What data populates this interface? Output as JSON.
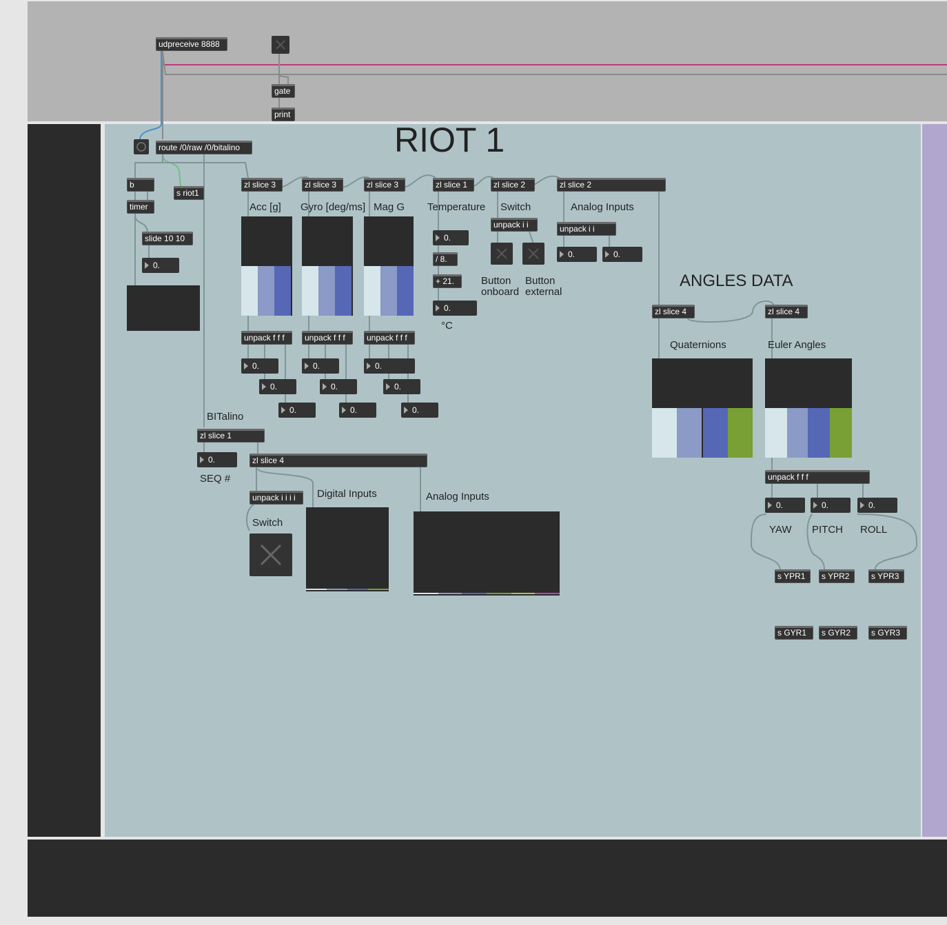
{
  "top": {
    "udpreceive": "udpreceive 8888",
    "gate": "gate",
    "print": "print"
  },
  "main": {
    "title": "RIOT 1",
    "route": "route /0/raw /0/bitalino",
    "b": "b",
    "timer": "timer",
    "s_riot1": "s riot1",
    "slide": "slide 10 10",
    "slide_value": "0.",
    "zl3a": "zl slice 3",
    "zl3b": "zl slice 3",
    "zl3c": "zl slice 3",
    "zl1": "zl slice 1",
    "zl2a": "zl slice 2",
    "zl2b": "zl slice 2",
    "acc_label": "Acc [g]",
    "gyro_label": "Gyro [deg/ms]",
    "mag_label": "Mag G",
    "temp_label": "Temperature",
    "switch_label": "Switch",
    "analog_label": "Analog Inputs",
    "unpack_ii_a": "unpack i i",
    "unpack_ii_b": "unpack i i",
    "temp_value": "0.",
    "div": "/ 8.",
    "plus": "+ 21.",
    "temp_result": "0.",
    "celsius": "°C",
    "btn_onboard": "Button\nonboard",
    "btn_external": "Button\nexternal",
    "analog_v1": "0.",
    "analog_v2": "0.",
    "unpack_fff": "unpack f f f",
    "acc_vals": [
      "0.",
      "0.",
      "0."
    ],
    "gyro_vals": [
      "0.",
      "0.",
      "0."
    ],
    "mag_vals": [
      "0.",
      "0.",
      "0."
    ],
    "angles_title": "ANGLES DATA",
    "zl4a": "zl slice 4",
    "zl4b": "zl slice 4",
    "quat_label": "Quaternions",
    "euler_label": "Euler Angles",
    "unpack_fff_euler": "unpack f f f",
    "ypr_vals": [
      "0.",
      "0.",
      "0."
    ],
    "yaw": "YAW",
    "pitch": "PITCH",
    "roll": "ROLL",
    "s_ypr": [
      "s YPR1",
      "s YPR2",
      "s YPR3"
    ],
    "s_gyr": [
      "s GYR1",
      "s GYR2",
      "s GYR3"
    ],
    "bitalino_label": "BITalino",
    "zl1_bit": "zl slice 1",
    "seq_value": "0.",
    "seq_label": "SEQ #",
    "zl4_bit": "zl slice 4",
    "unpack_iiii": "unpack i i i i",
    "digital_label": "Digital Inputs",
    "analog_label2": "Analog Inputs",
    "switch_label2": "Switch"
  },
  "colors": {
    "canvas_top": "#b3b3b3",
    "patch_bg": "#afc3c7",
    "dark": "#2b2b2b",
    "cable": "#7f9597",
    "pink_cable": "#c03a7a",
    "purple_panel": "#b1a6cd",
    "ms1": "#d6e6ea",
    "ms2": "#8b9ac6",
    "ms3": "#5567b5",
    "ms4": "#78a034"
  }
}
